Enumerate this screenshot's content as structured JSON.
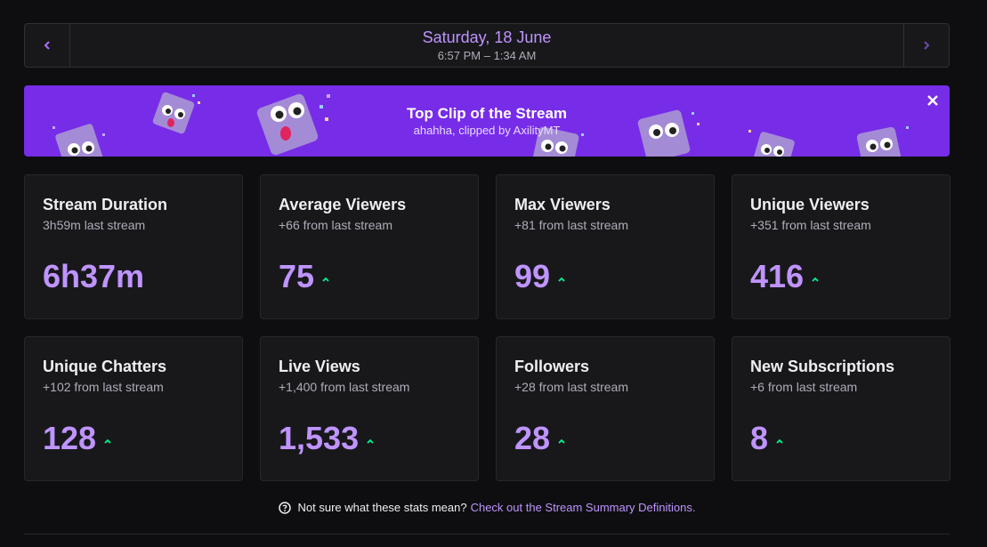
{
  "date_nav": {
    "prev_icon": "chevron-left-icon",
    "next_icon": "chevron-right-icon",
    "title": "Saturday, 18 June",
    "time_range": "6:57 PM – 1:34 AM"
  },
  "banner": {
    "title": "Top Clip of the Stream",
    "subtitle": "ahahha, clipped by AxilityMT",
    "close_icon": "close-icon",
    "background": "#772ce8"
  },
  "stats": [
    {
      "title": "Stream Duration",
      "sub": "3h59m last stream",
      "value": "6h37m",
      "trend": ""
    },
    {
      "title": "Average Viewers",
      "sub": "+66 from last stream",
      "value": "75",
      "trend": "up"
    },
    {
      "title": "Max Viewers",
      "sub": "+81 from last stream",
      "value": "99",
      "trend": "up"
    },
    {
      "title": "Unique Viewers",
      "sub": "+351 from last stream",
      "value": "416",
      "trend": "up"
    },
    {
      "title": "Unique Chatters",
      "sub": "+102 from last stream",
      "value": "128",
      "trend": "up"
    },
    {
      "title": "Live Views",
      "sub": "+1,400 from last stream",
      "value": "1,533",
      "trend": "up"
    },
    {
      "title": "Followers",
      "sub": "+28 from last stream",
      "value": "28",
      "trend": "up"
    },
    {
      "title": "New Subscriptions",
      "sub": "+6 from last stream",
      "value": "8",
      "trend": "up"
    }
  ],
  "help": {
    "icon": "question-circle-icon",
    "text": "Not sure what these stats mean?",
    "link": "Check out the Stream Summary Definitions."
  },
  "colors": {
    "accent": "#bf94ff",
    "trend_up": "#00f593",
    "card_bg": "#18181b",
    "page_bg": "#0e0e10"
  }
}
